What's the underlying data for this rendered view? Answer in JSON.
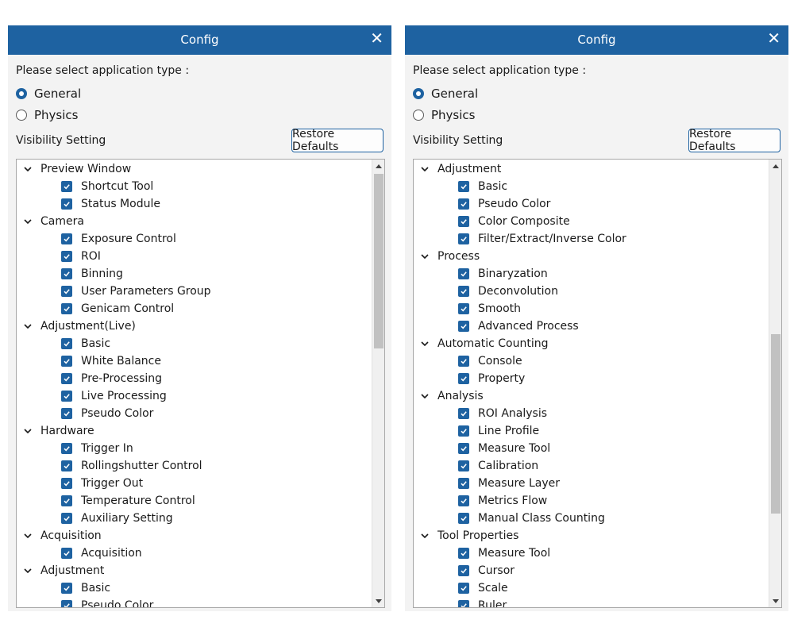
{
  "panels": [
    {
      "title": "Config",
      "close_glyph": "✕",
      "prompt": "Please select application type :",
      "app_types": [
        {
          "label": "General",
          "selected": true
        },
        {
          "label": "Physics",
          "selected": false
        }
      ],
      "visibility_label": "Visibility Setting",
      "restore_label": "Restore Defaults",
      "tree": [
        {
          "label": "Preview Window",
          "expanded": true,
          "children": [
            "Shortcut Tool",
            "Status Module"
          ]
        },
        {
          "label": "Camera",
          "expanded": true,
          "children": [
            "Exposure Control",
            "ROI",
            "Binning",
            "User Parameters Group",
            "Genicam Control"
          ]
        },
        {
          "label": "Adjustment(Live)",
          "expanded": true,
          "children": [
            "Basic",
            "White Balance",
            "Pre-Processing",
            "Live Processing",
            "Pseudo Color"
          ]
        },
        {
          "label": "Hardware",
          "expanded": true,
          "children": [
            "Trigger In",
            "Rollingshutter Control",
            "Trigger Out",
            "Temperature Control",
            "Auxiliary Setting"
          ]
        },
        {
          "label": "Acquisition",
          "expanded": true,
          "children": [
            "Acquisition"
          ]
        },
        {
          "label": "Adjustment",
          "expanded": true,
          "children": [
            "Basic",
            "Pseudo Color"
          ]
        }
      ]
    },
    {
      "title": "Config",
      "close_glyph": "✕",
      "prompt": "Please select application type :",
      "app_types": [
        {
          "label": "General",
          "selected": true
        },
        {
          "label": "Physics",
          "selected": false
        }
      ],
      "visibility_label": "Visibility Setting",
      "restore_label": "Restore Defaults",
      "tree": [
        {
          "label": "Adjustment",
          "expanded": true,
          "children": [
            "Basic",
            "Pseudo Color",
            "Color Composite",
            "Filter/Extract/Inverse Color"
          ]
        },
        {
          "label": "Process",
          "expanded": true,
          "children": [
            "Binaryzation",
            "Deconvolution",
            "Smooth",
            "Advanced Process"
          ]
        },
        {
          "label": "Automatic Counting",
          "expanded": true,
          "children": [
            "Console",
            "Property"
          ]
        },
        {
          "label": "Analysis",
          "expanded": true,
          "children": [
            "ROI Analysis",
            "Line Profile",
            "Measure Tool",
            "Calibration",
            "Measure Layer",
            "Metrics Flow",
            "Manual Class Counting"
          ]
        },
        {
          "label": "Tool Properties",
          "expanded": true,
          "children": [
            "Measure Tool",
            "Cursor",
            "Scale",
            "Ruler"
          ]
        }
      ]
    }
  ],
  "icons": {
    "close": "close-icon",
    "chevron": "chevron-down-icon",
    "checkbox": "checkbox-checked-icon",
    "scroll_up": "scroll-up-arrow-icon",
    "scroll_down": "scroll-down-arrow-icon"
  },
  "colors": {
    "titlebar": "#1e62a1",
    "accent": "#1e62a1",
    "panel_bg": "#f3f3f3",
    "tree_bg": "#ffffff",
    "scroll_thumb": "#c1c1c1"
  },
  "scroll_state": {
    "left_tree_scrolled": false,
    "right_tree_scrolled": true
  }
}
